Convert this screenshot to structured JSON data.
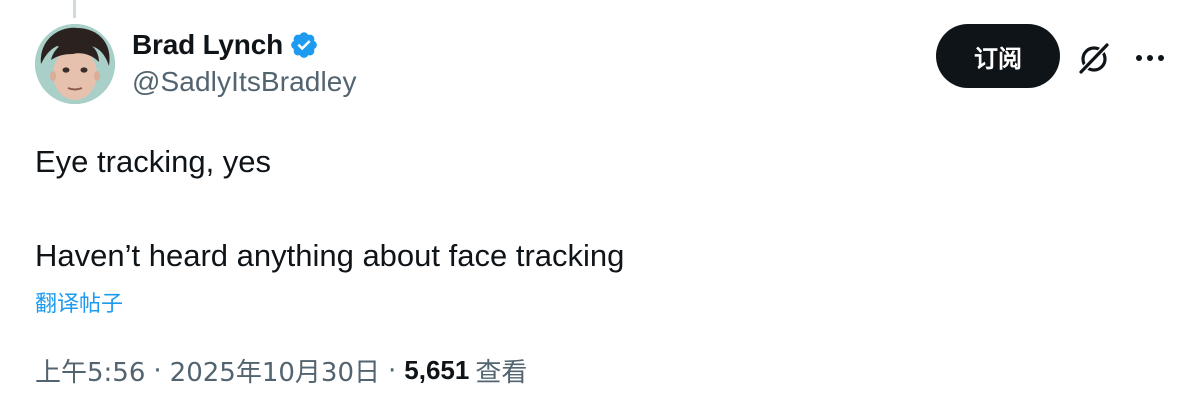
{
  "author": {
    "display_name": "Brad Lynch",
    "handle": "@SadlyItsBradley",
    "verified": true,
    "verified_color": "#1d9bf0",
    "avatar_icon": "user-avatar-photo"
  },
  "actions": {
    "subscribe_label": "订阅",
    "grok_icon": "grok-slash-icon",
    "more_icon": "more-horizontal-icon"
  },
  "tweet": {
    "text": "Eye tracking, yes\n\nHaven’t heard anything about face tracking",
    "translate_label": "翻译帖子"
  },
  "meta": {
    "time": "上午5:56",
    "separator": "·",
    "date": "2025年10月30日",
    "views_count": "5,651",
    "views_label": "查看"
  },
  "colors": {
    "text_primary": "#0f1419",
    "text_secondary": "#536471",
    "link": "#1d9bf0",
    "button_bg": "#0f1419"
  }
}
